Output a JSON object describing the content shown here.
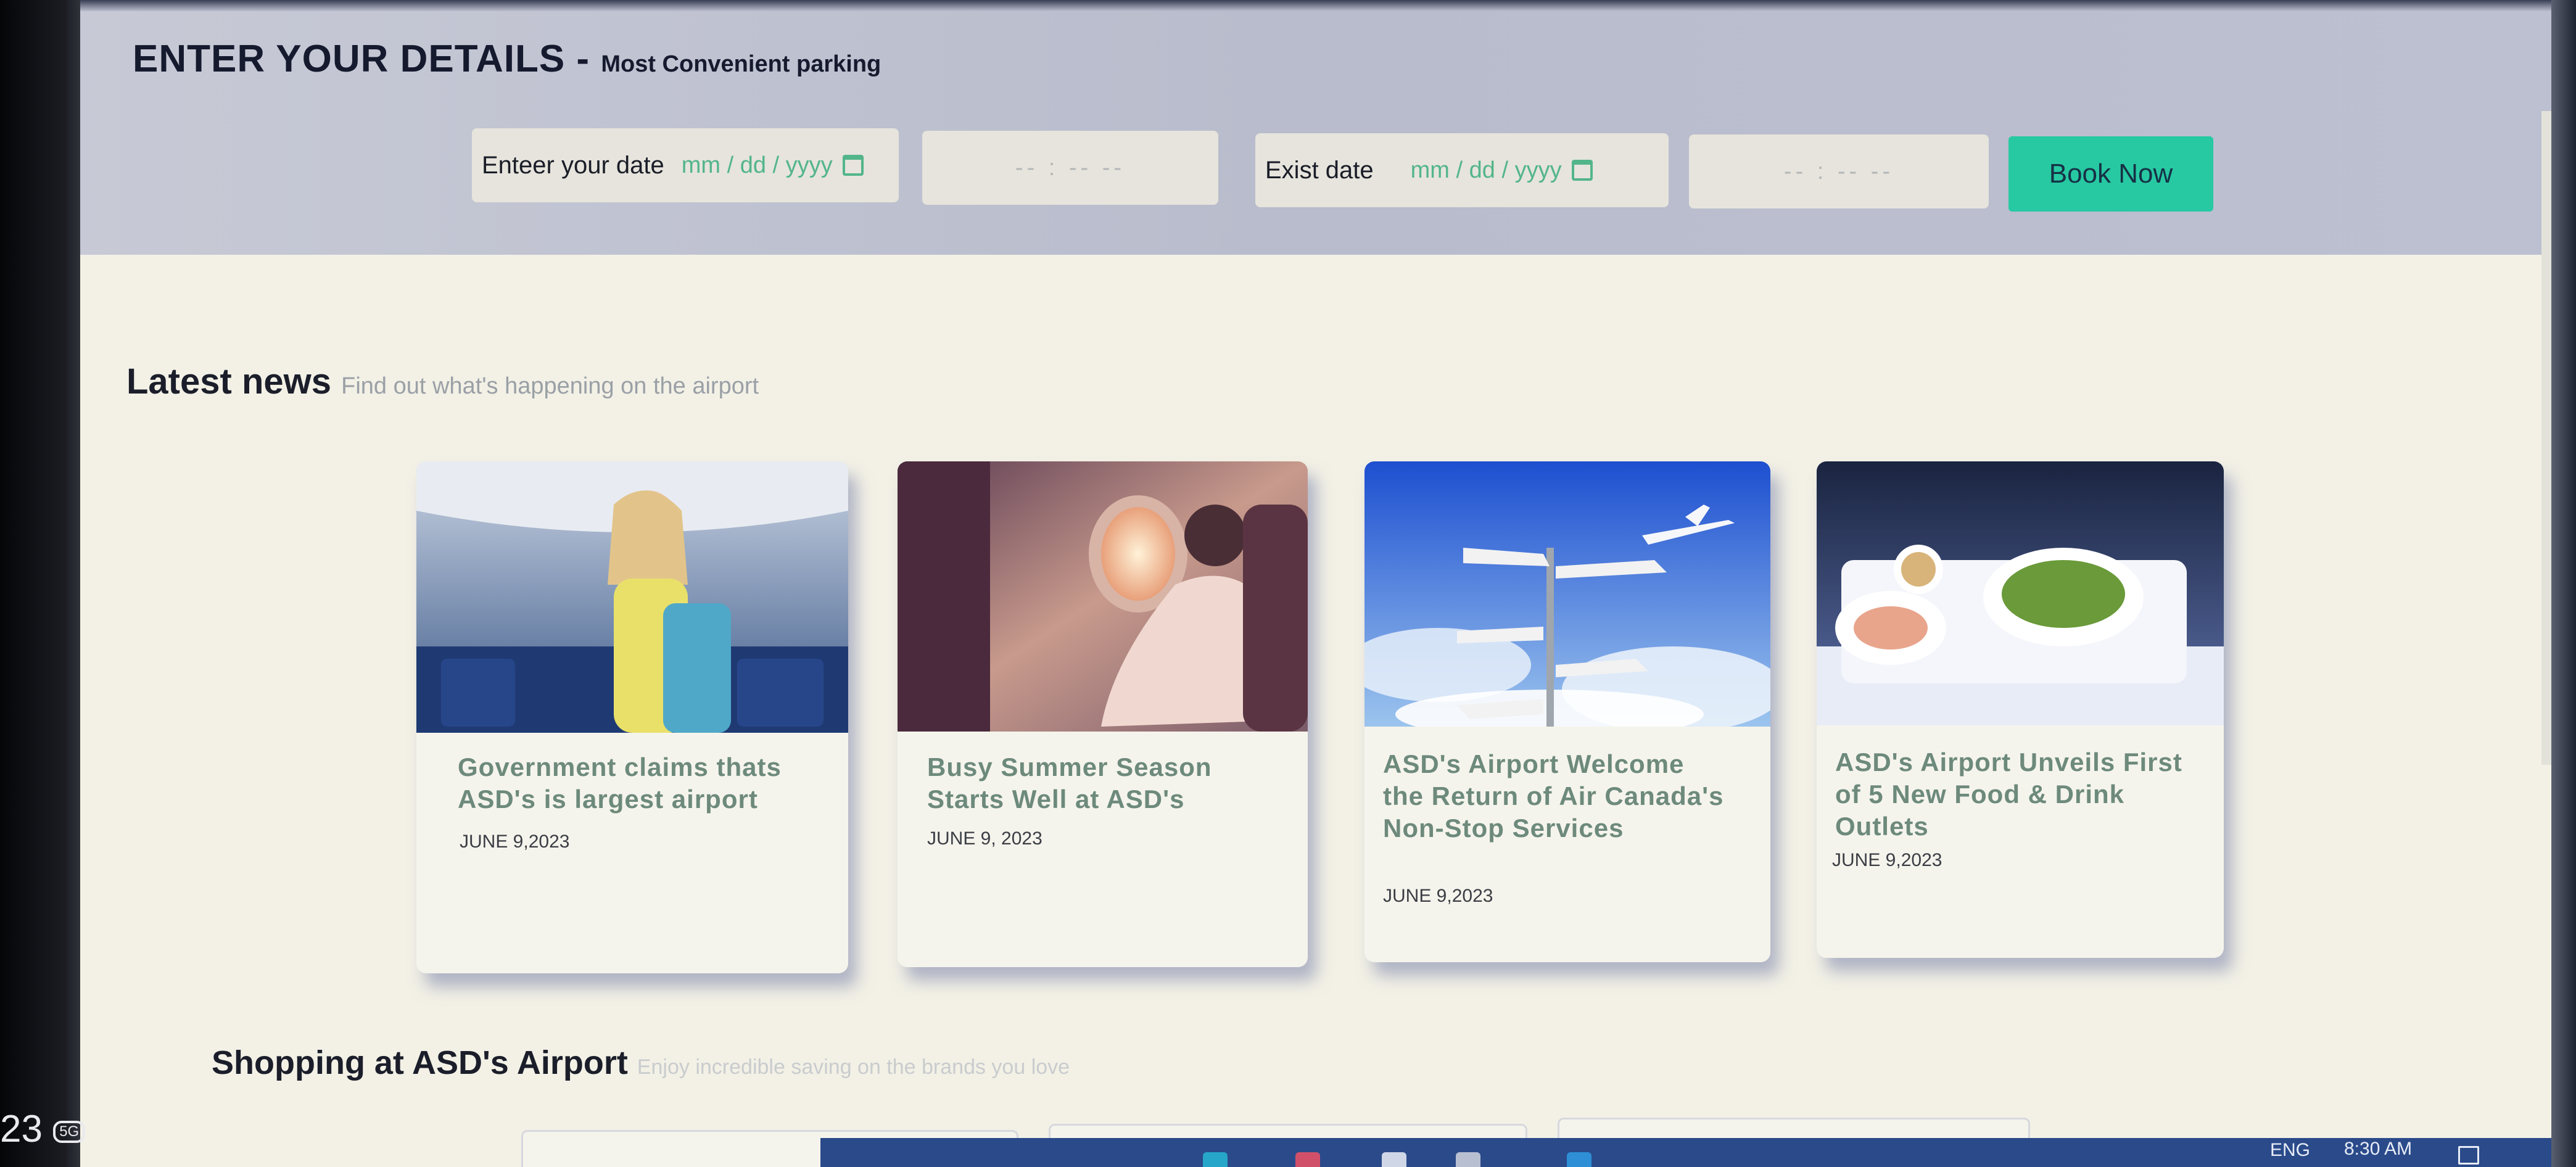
{
  "booking": {
    "title": "ENTER YOUR DETAILS -",
    "subtitle": "Most Convenient parking",
    "entry_label": "Enteer your date",
    "entry_date_placeholder": "mm / dd / yyyy",
    "entry_time_placeholder": "-- : --  --",
    "exit_label": "Exist date",
    "exit_date_placeholder": "mm / dd / yyyy",
    "exit_time_placeholder": "-- : --  --",
    "book_button": "Book Now"
  },
  "news": {
    "title": "Latest news",
    "subtitle": "Find out what's happening on the airport",
    "items": [
      {
        "title": "Government claims thats ASD's is largest airport",
        "date": "JUNE 9,2023",
        "image": "smiling-passenger-photo"
      },
      {
        "title": "Busy Summer Season Starts Well at ASD's",
        "date": "JUNE 9, 2023",
        "image": "window-seat-photo"
      },
      {
        "title": "ASD's Airport Welcome the Return of Air Canada's Non-Stop Services",
        "date": "JUNE 9,2023",
        "image": "signpost-airplane-photo"
      },
      {
        "title": "ASD's Airport Unveils First of 5 New Food & Drink Outlets",
        "date": "JUNE 9,2023",
        "image": "inflight-meal-photo"
      }
    ]
  },
  "shopping": {
    "title": "Shopping at ASD's Airport",
    "subtitle": "Enjoy incredible saving on the brands you love"
  },
  "taskbar": {
    "language": "ENG",
    "time": "8:30 AM"
  },
  "overlay": {
    "camera_mark": "23",
    "camera_badge": "5G"
  },
  "colors": {
    "accent_button": "#27c9a3",
    "card_title": "#6d8a7c",
    "date_green": "#53b58a"
  }
}
